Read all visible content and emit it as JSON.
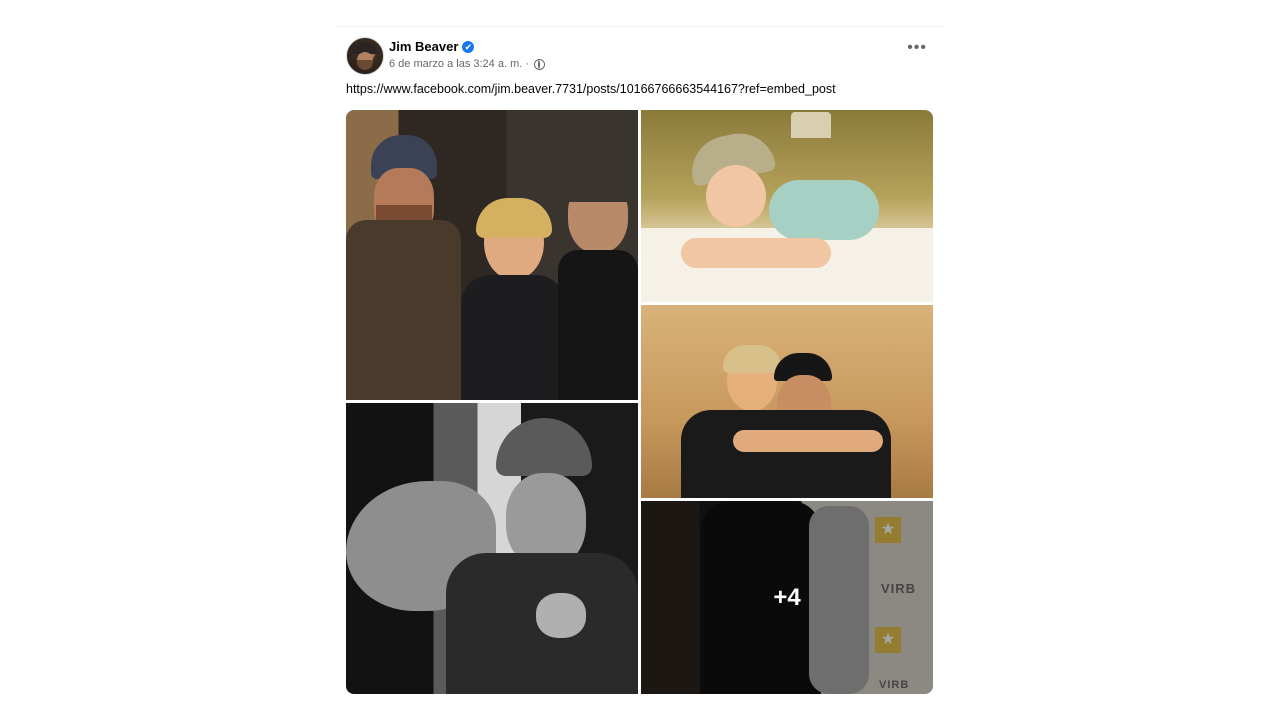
{
  "post": {
    "author_name": "Jim Beaver",
    "verified_mark": "✔",
    "timestamp": "6 de marzo a las 3:24 a. m. ·",
    "more_options": "•••",
    "text": "https://www.facebook.com/jim.beaver.7731/posts/10166766663544167?ref=embed_post"
  },
  "photos": {
    "remaining_count": "+4",
    "brand_text_1": "VIRB",
    "brand_text_2": "VIRB"
  }
}
